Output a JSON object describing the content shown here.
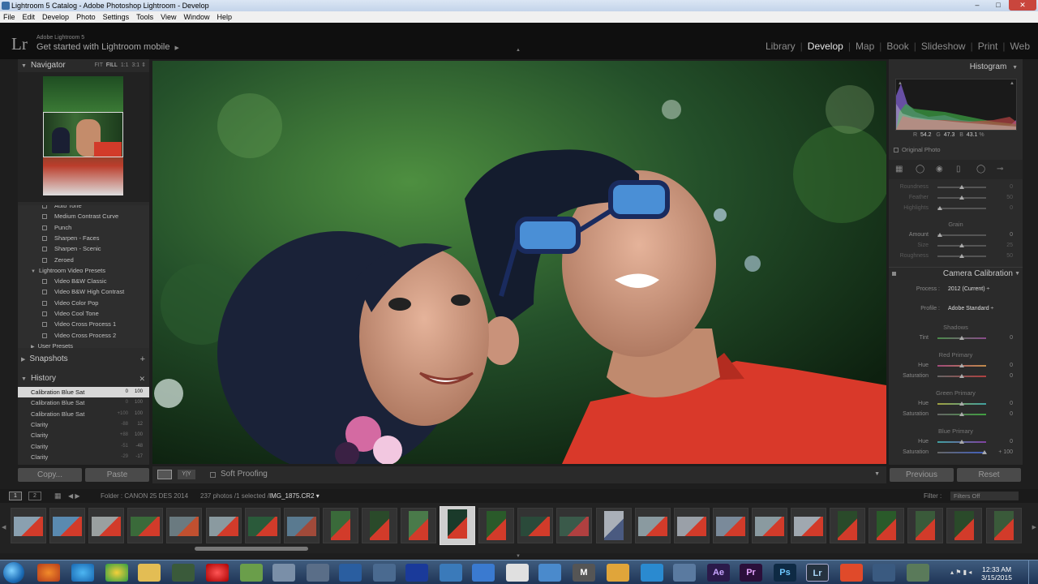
{
  "window": {
    "title": "Lightroom 5 Catalog - Adobe Photoshop Lightroom - Develop"
  },
  "menu": [
    "File",
    "Edit",
    "Develop",
    "Photo",
    "Settings",
    "Tools",
    "View",
    "Window",
    "Help"
  ],
  "brand": {
    "logo": "Lr",
    "line1": "Adobe Lightroom 5",
    "line2": "Get started with Lightroom mobile",
    "line2_arrow": "▶"
  },
  "modules": {
    "items": [
      "Library",
      "Develop",
      "Map",
      "Book",
      "Slideshow",
      "Print",
      "Web"
    ],
    "active": "Develop"
  },
  "navigator": {
    "title": "Navigator",
    "opts": {
      "fit": "FIT",
      "fill": "FILL",
      "one": "1:1",
      "three": "3:1"
    }
  },
  "presets": {
    "rows": [
      {
        "label": "Auto Tone",
        "type": "item"
      },
      {
        "label": "Medium Contrast Curve",
        "type": "item"
      },
      {
        "label": "Punch",
        "type": "item"
      },
      {
        "label": "Sharpen - Faces",
        "type": "item"
      },
      {
        "label": "Sharpen - Scenic",
        "type": "item"
      },
      {
        "label": "Zeroed",
        "type": "item"
      },
      {
        "label": "Lightroom Video Presets",
        "type": "folder-open"
      },
      {
        "label": "Video B&W Classic",
        "type": "item"
      },
      {
        "label": "Video B&W High Contrast",
        "type": "item"
      },
      {
        "label": "Video Color Pop",
        "type": "item"
      },
      {
        "label": "Video Cool Tone",
        "type": "item"
      },
      {
        "label": "Video Cross Process 1",
        "type": "item"
      },
      {
        "label": "Video Cross Process 2",
        "type": "item"
      },
      {
        "label": "User Presets",
        "type": "folder-closed"
      }
    ]
  },
  "snapshots": {
    "title": "Snapshots",
    "add": "+"
  },
  "history": {
    "title": "History",
    "close": "✕",
    "rows": [
      {
        "label": "Calibration Blue Sat",
        "v1": "0",
        "v2": "100",
        "selected": true
      },
      {
        "label": "Calibration Blue Sat",
        "v1": "0",
        "v2": "100",
        "selected": false
      },
      {
        "label": "Calibration Blue Sat",
        "v1": "+100",
        "v2": "100",
        "selected": false
      },
      {
        "label": "Clarity",
        "v1": "-88",
        "v2": "12",
        "selected": false
      },
      {
        "label": "Clarity",
        "v1": "+88",
        "v2": "100",
        "selected": false
      },
      {
        "label": "Clarity",
        "v1": "-51",
        "v2": "-48",
        "selected": false
      },
      {
        "label": "Clarity",
        "v1": "-29",
        "v2": "-17",
        "selected": false
      }
    ]
  },
  "left_buttons": {
    "copy": "Copy...",
    "paste": "Paste"
  },
  "toolbar": {
    "view_compare": "Y|Y",
    "soft_proofing": "Soft Proofing",
    "dropdown": "▼"
  },
  "histogram": {
    "title": "Histogram",
    "r_label": "R",
    "r": "54.2",
    "g_label": "G",
    "g": "47.3",
    "b_label": "B",
    "b": "43.1",
    "pct": "%",
    "original_photo": "Original Photo"
  },
  "effects": {
    "rows": [
      {
        "label": "Roundness",
        "value": "0",
        "dim": true,
        "pos": 0.5
      },
      {
        "label": "Feather",
        "value": "50",
        "dim": true,
        "pos": 0.5
      },
      {
        "label": "Highlights",
        "value": "0",
        "dim": true,
        "pos": 0.05
      }
    ],
    "grain_label": "Grain",
    "grain_rows": [
      {
        "label": "Amount",
        "value": "0",
        "dim": false,
        "pos": 0.05
      },
      {
        "label": "Size",
        "value": "25",
        "dim": true,
        "pos": 0.5
      },
      {
        "label": "Roughness",
        "value": "50",
        "dim": true,
        "pos": 0.5
      }
    ]
  },
  "calibration": {
    "title": "Camera Calibration",
    "process_label": "Process :",
    "process_value": "2012 (Current) ÷",
    "profile_label": "Profile :",
    "profile_value": "Adobe Standard ÷",
    "shadows_label": "Shadows",
    "shadows_rows": [
      {
        "label": "Tint",
        "value": "0",
        "pos": 0.5
      }
    ],
    "red_label": "Red Primary",
    "red_rows": [
      {
        "label": "Hue",
        "value": "0",
        "pos": 0.5
      },
      {
        "label": "Saturation",
        "value": "0",
        "pos": 0.5
      }
    ],
    "green_label": "Green Primary",
    "green_rows": [
      {
        "label": "Hue",
        "value": "0",
        "pos": 0.5
      },
      {
        "label": "Saturation",
        "value": "0",
        "pos": 0.5
      }
    ],
    "blue_label": "Blue Primary",
    "blue_rows": [
      {
        "label": "Hue",
        "value": "0",
        "pos": 0.5
      },
      {
        "label": "Saturation",
        "value": "+ 100",
        "pos": 0.97
      }
    ]
  },
  "right_buttons": {
    "previous": "Previous",
    "reset": "Reset"
  },
  "filmbar": {
    "page1": "1",
    "page2": "2",
    "folder": "Folder : CANON 25 DES 2014",
    "count": "237 photos /1 selected /",
    "filename": "IMG_1875.CR2 ▾",
    "filter_label": "Filter :",
    "filter_value": "Filters Off"
  },
  "taskbar": {
    "time": "12:33 AM",
    "date": "3/15/2015",
    "apps": [
      "M",
      "Ae",
      "Pr",
      "Ps",
      "Lr"
    ]
  },
  "colors": {
    "accent": "#e6e6e6",
    "panel": "#2b2b2b",
    "shirt": "#d23b2a",
    "hijab": "#1a2238"
  }
}
